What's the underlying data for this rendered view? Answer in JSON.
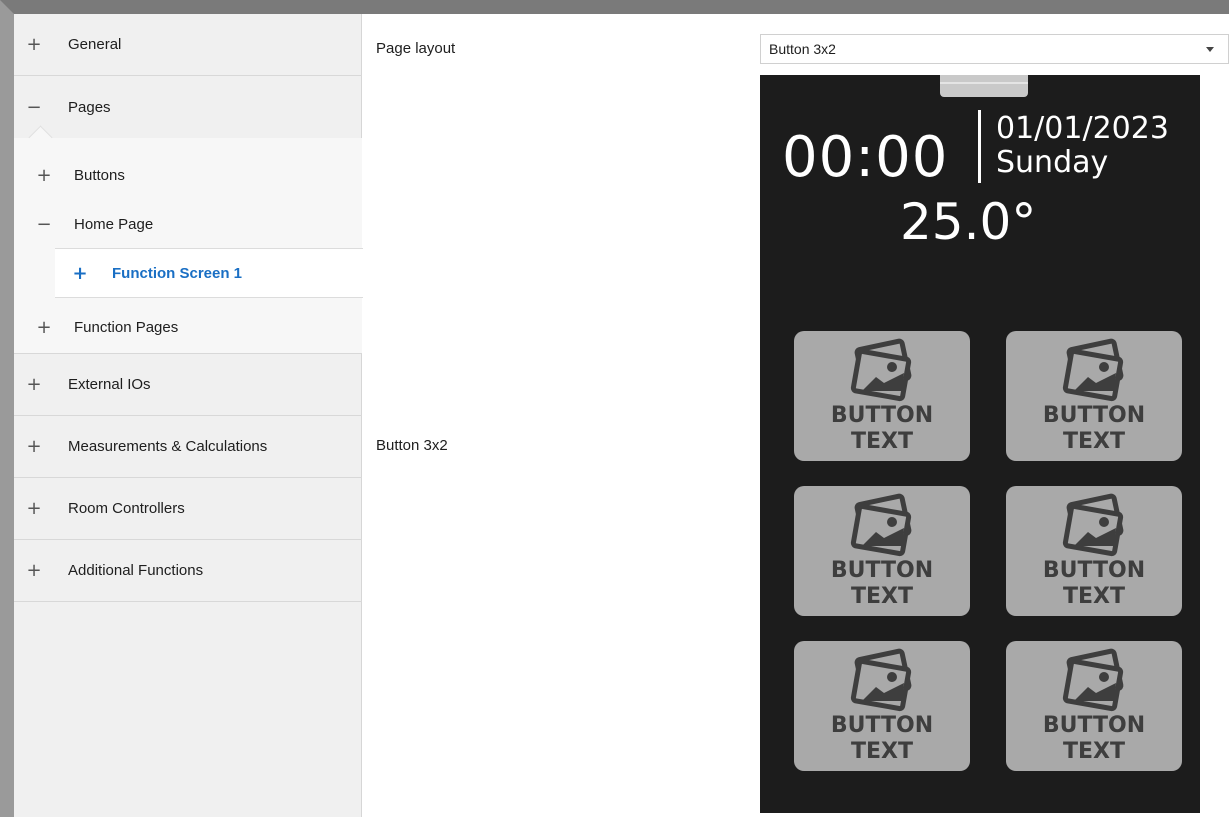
{
  "sidebar": {
    "items": [
      {
        "sign": "+",
        "label": "General"
      },
      {
        "sign": "−",
        "label": "Pages"
      },
      {
        "sign": "+",
        "label": "External IOs"
      },
      {
        "sign": "+",
        "label": "Measurements & Calculations"
      },
      {
        "sign": "+",
        "label": "Room Controllers"
      },
      {
        "sign": "+",
        "label": "Additional Functions"
      }
    ],
    "pages_children": [
      {
        "sign": "+",
        "label": "Buttons"
      },
      {
        "sign": "−",
        "label": "Home Page"
      },
      {
        "sign": "+",
        "label": "Function Pages"
      }
    ],
    "selected": {
      "sign": "+",
      "label": "Function Screen 1"
    }
  },
  "main": {
    "page_layout_label": "Page layout",
    "page_layout_value": "Button 3x2",
    "preview_caption": "Button 3x2"
  },
  "preview": {
    "time": "00:00",
    "date": "01/01/2023",
    "day": "Sunday",
    "temperature": "25.0°",
    "button_line1": "BUTTON",
    "button_line2": "TEXT",
    "button_icon": "image-placeholder-icon"
  },
  "colors": {
    "accent": "#1a6fc4",
    "preview_bg": "#1c1c1c",
    "button_bg": "#a9a9a9"
  }
}
